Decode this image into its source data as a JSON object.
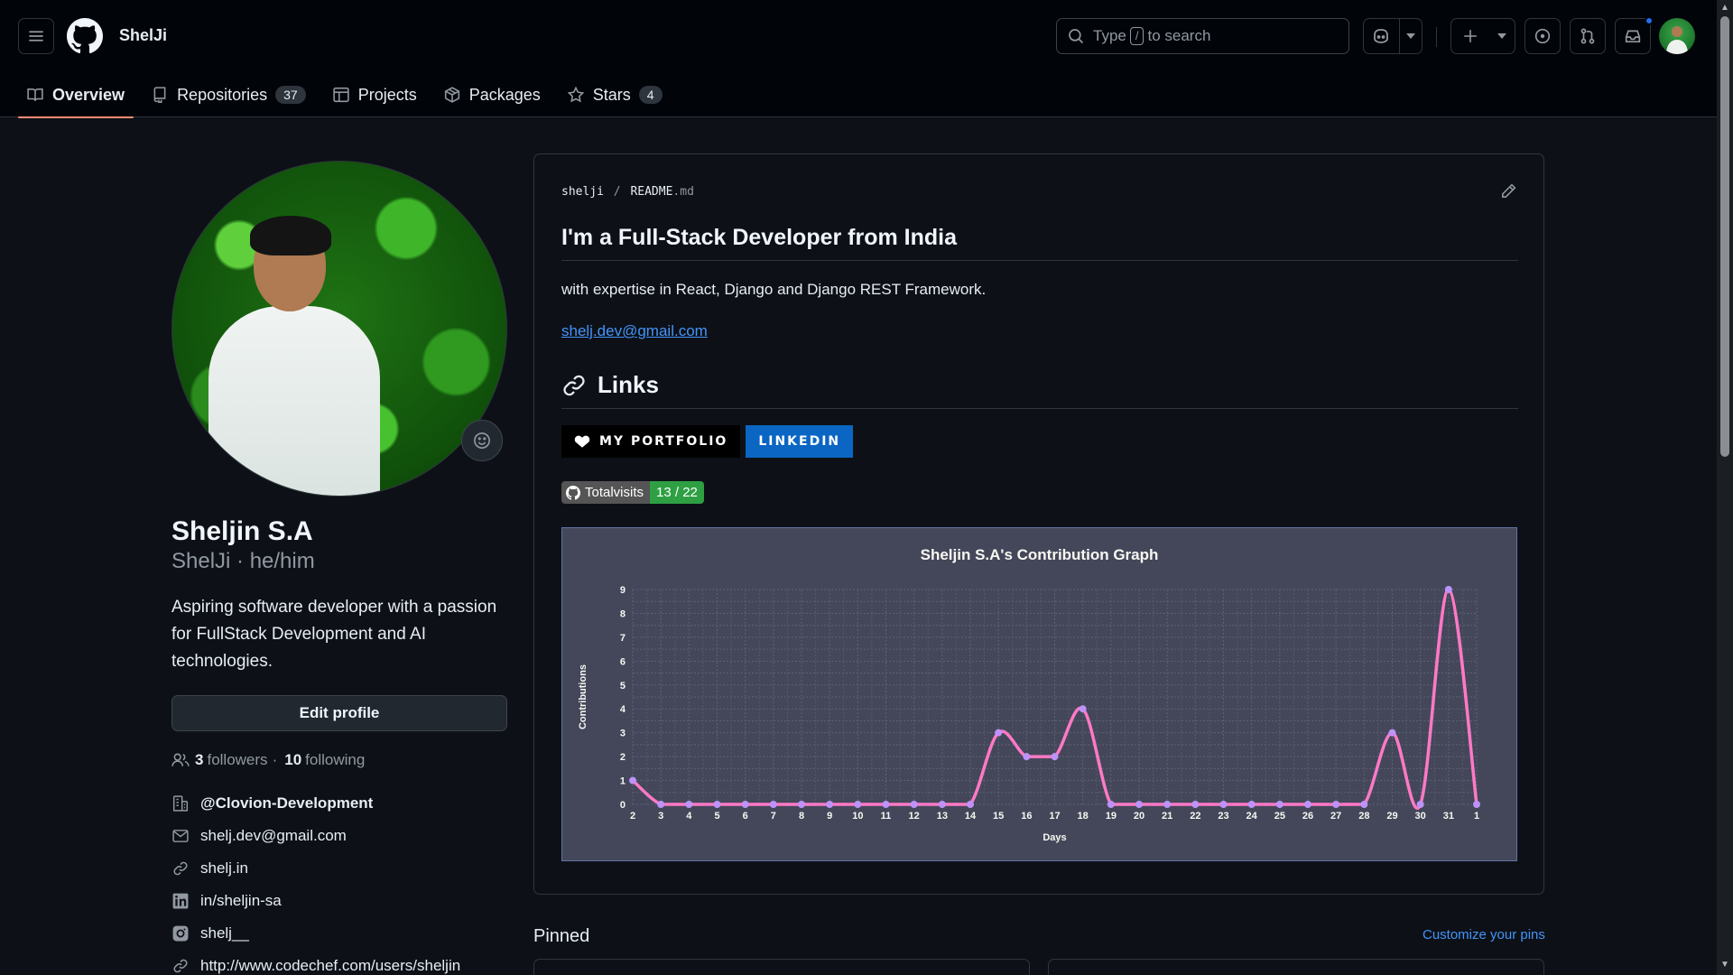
{
  "header": {
    "username": "ShelJi",
    "search_placeholder_before": "Type",
    "search_key": "/",
    "search_placeholder_after": "to search"
  },
  "tabs": [
    {
      "label": "Overview",
      "count": null,
      "icon": "book-icon"
    },
    {
      "label": "Repositories",
      "count": "37",
      "icon": "repo-icon"
    },
    {
      "label": "Projects",
      "count": null,
      "icon": "table-icon"
    },
    {
      "label": "Packages",
      "count": null,
      "icon": "package-icon"
    },
    {
      "label": "Stars",
      "count": "4",
      "icon": "star-icon"
    }
  ],
  "profile": {
    "name": "Sheljin S.A",
    "handle": "ShelJi · he/him",
    "bio": "Aspiring software developer with a passion for FullStack Development and AI technologies.",
    "edit_label": "Edit profile",
    "followers_count": "3",
    "followers_label": "followers",
    "separator": "·",
    "following_count": "10",
    "following_label": "following",
    "details": {
      "org": "@Clovion-Development",
      "email": "shelj.dev@gmail.com",
      "website": "shelj.in",
      "linkedin": "in/sheljin-sa",
      "instagram": "shelj__",
      "codechef": "http://www.codechef.com/users/sheljin"
    }
  },
  "readme": {
    "crumb_user": "shelji",
    "crumb_sep": "/",
    "crumb_file": "README",
    "crumb_ext": ".md",
    "heading": "I'm a Full-Stack Developer from India",
    "intro": "with expertise in React, Django and Django REST Framework.",
    "email": "shelj.dev@gmail.com",
    "links_heading": "Links",
    "badge_portfolio": "MY PORTFOLIO",
    "badge_linkedin": "LINKEDIN",
    "visits_label": "Totalvisits",
    "visits_value": "13 / 22"
  },
  "chart_data": {
    "type": "line",
    "title": "Sheljin S.A's Contribution Graph",
    "xlabel": "Days",
    "ylabel": "Contributions",
    "categories": [
      "2",
      "3",
      "4",
      "5",
      "6",
      "7",
      "8",
      "9",
      "10",
      "11",
      "12",
      "13",
      "14",
      "15",
      "16",
      "17",
      "18",
      "19",
      "20",
      "21",
      "22",
      "23",
      "24",
      "25",
      "26",
      "27",
      "28",
      "29",
      "30",
      "31",
      "1"
    ],
    "series": [
      {
        "values": [
          1,
          0,
          0,
          0,
          0,
          0,
          0,
          0,
          0,
          0,
          0,
          0,
          0,
          3,
          2,
          2,
          4,
          0,
          0,
          0,
          0,
          0,
          0,
          0,
          0,
          0,
          0,
          3,
          0,
          9,
          0
        ]
      }
    ],
    "ylim": [
      0,
      9
    ],
    "yticks": [
      0,
      1,
      2,
      3,
      4,
      5,
      6,
      7,
      8,
      9
    ],
    "grid": true,
    "line_color": "#ff79c6",
    "point_color": "#bd93f9",
    "background": "#44475a"
  },
  "pinned": {
    "title": "Pinned",
    "customize": "Customize your pins"
  },
  "colors": {
    "accent_tab": "#fd8c73",
    "link": "#4493f8",
    "visits_green": "#2ea043",
    "linkedin_blue": "#0a66c2"
  }
}
